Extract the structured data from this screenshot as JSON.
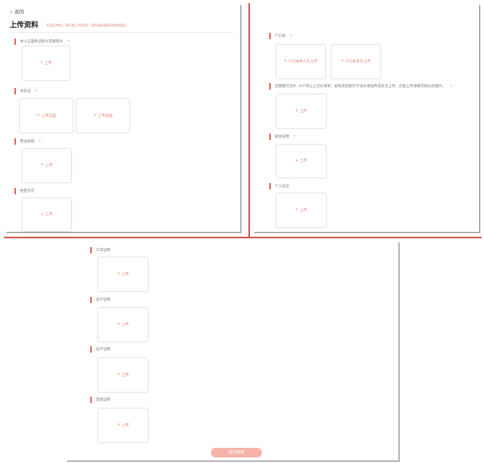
{
  "header": {
    "back_label": "返回",
    "title": "上传资料",
    "hint": "为保证审核，请仔细上传资料，资料越多越容易审核通过"
  },
  "sections": {
    "s1": {
      "label": "本人正面免冠照片或者照片",
      "required": "*",
      "upload": "上传"
    },
    "s2": {
      "label": "身份证",
      "required": "*",
      "upload_front": "上传正面",
      "upload_back": "上传反面"
    },
    "s3": {
      "label": "营业执照",
      "required": "*",
      "upload": "上传"
    },
    "s4": {
      "label": "经营许可",
      "upload": "上传"
    },
    "s5": {
      "label": "户口本",
      "required": "*",
      "upload_left": "户口本本人页上传",
      "upload_right": "户口本首页上传"
    },
    "s6": {
      "label": "近期银行流水（6个月以上流水清单，如有其他银行卡流水请加传或多次上传，仅能上传清晰可辨认的图片）",
      "required": "*",
      "upload": "上传"
    },
    "s7": {
      "label": "居住证明",
      "required": "*",
      "upload": "上传"
    },
    "s8": {
      "label": "个人征信",
      "upload": "上传"
    },
    "s9": {
      "label": "工作证明",
      "upload": "上传"
    },
    "s10": {
      "label": "资产证明",
      "upload": "上传"
    },
    "s11": {
      "label": "房产证明",
      "upload": "上传"
    },
    "s12": {
      "label": "其他证明",
      "upload": "上传"
    }
  },
  "footer": {
    "submit_label": "提交审核"
  },
  "colors": {
    "accent": "#E06B5E",
    "hint_text": "#E18C7C",
    "divider": "#D65A4E",
    "submit_bg": "#F7B3AA"
  },
  "icons": {
    "back": "chevron-left-icon",
    "upload": "plus-icon"
  }
}
